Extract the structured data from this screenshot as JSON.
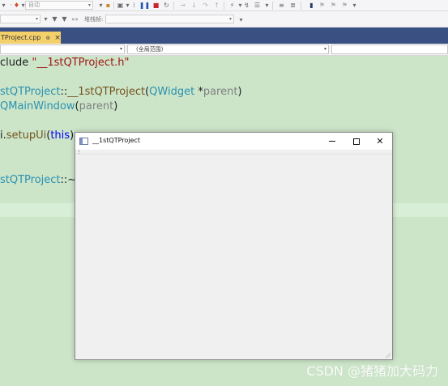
{
  "toolbar1": {
    "config_combo": "自动"
  },
  "toolbar2": {
    "stack_frame_label": "堆栈帧:"
  },
  "editor_tab": {
    "label": "TProject.cpp",
    "pin": "⊕",
    "close": "×"
  },
  "navbar": {
    "scope_combo": "(全局范围)"
  },
  "code_lines": {
    "l1": {
      "a": "clude ",
      "b": "\"__1stQTProject.h\""
    },
    "l2": {
      "a": "stQTProject",
      "b": "::",
      "c": "__1stQTProject",
      "d": "(",
      "e": "QWidget",
      "f": " *",
      "g": "parent",
      "h": ")"
    },
    "l3": {
      "a": "QMainWindow",
      "b": "(",
      "c": "parent",
      "d": ")"
    },
    "l4": {
      "a": "i.",
      "b": "setupUi",
      "c": "(",
      "d": "this",
      "e": ");"
    },
    "l5": {
      "a": "stQTProject",
      "b": "::~_"
    }
  },
  "app_window": {
    "title": "__1stQTProject"
  },
  "watermark": "CSDN @猪猪加大码力",
  "colors": {
    "editor_bg": "#cce5c9",
    "tab_bar": "#3a4f82",
    "active_tab": "#f4d06b",
    "string": "#a31515",
    "type": "#2b91af",
    "function": "#74531f",
    "keyword": "#0000ff"
  }
}
